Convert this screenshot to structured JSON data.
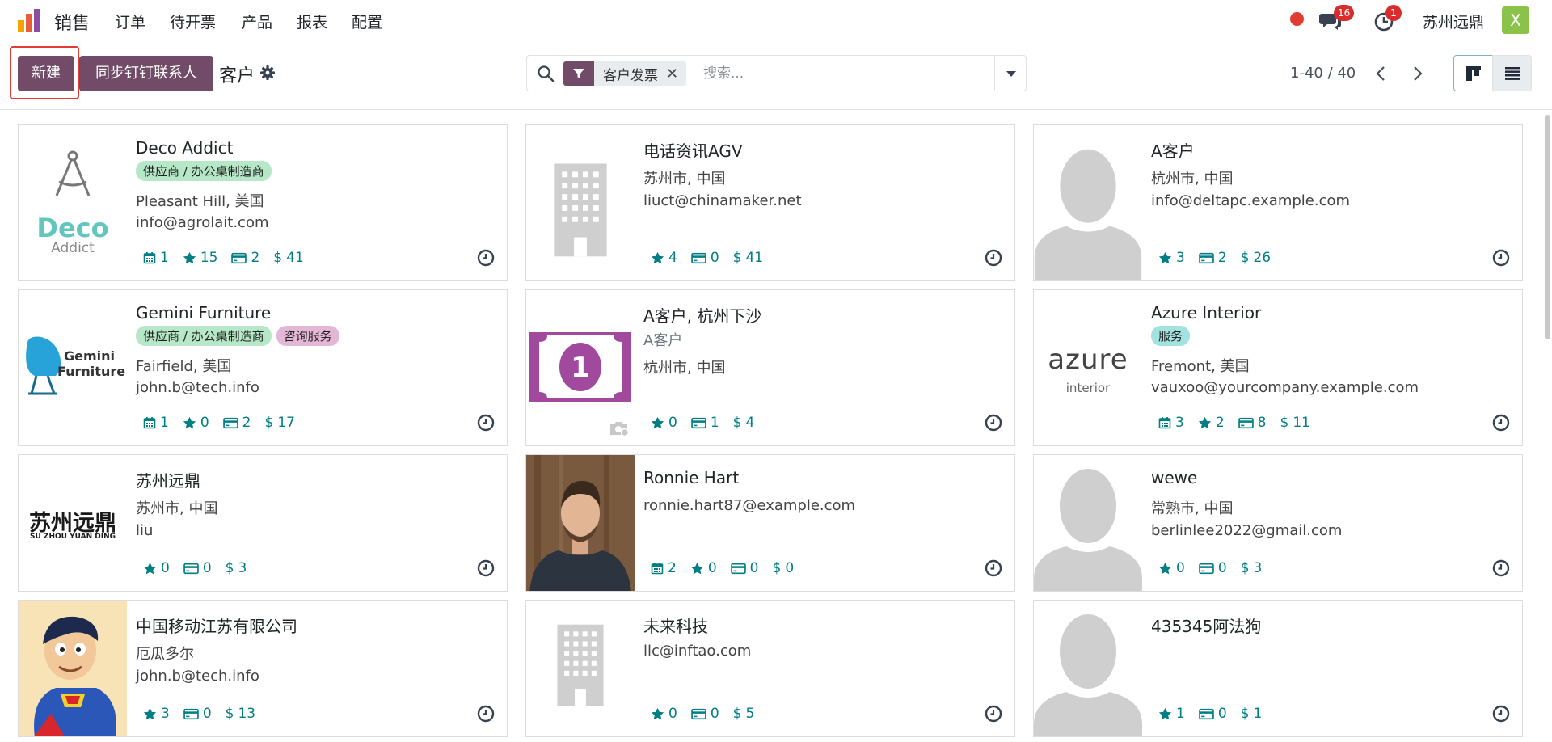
{
  "app": {
    "title": "销售",
    "menu": [
      "订单",
      "待开票",
      "产品",
      "报表",
      "配置"
    ],
    "messages_count": "16",
    "activities_count": "1",
    "company": "苏州远鼎",
    "user_initial": "X"
  },
  "actions": {
    "new_label": "新建",
    "sync_label": "同步钉钉联系人"
  },
  "breadcrumb": "客户",
  "search": {
    "facet": "客户发票",
    "placeholder": "搜索..."
  },
  "pager": "1-40 / 40",
  "colors": {
    "primary": "#714b67",
    "stat": "#017e84",
    "tag_supplier": "#b6e8c8",
    "tag_consult": "#e5b7d6",
    "tag_service": "#a2e3e2"
  },
  "cards": [
    {
      "name": "Deco Addict",
      "tags": [
        "供应商 / 办公桌制造商"
      ],
      "lines": [
        "Pleasant Hill, 美国",
        "info@agrolait.com"
      ],
      "image": "deco-addict-logo",
      "logo_text": [
        "Deco",
        "Addict"
      ],
      "stats": {
        "meetings": "1",
        "rating": "15",
        "invoices": "2",
        "sales": "41"
      }
    },
    {
      "name": "电话资讯AGV",
      "tags": [],
      "lines": [
        "苏州市, 中国",
        "liuct@chinamaker.net"
      ],
      "image": "building-placeholder",
      "stats": {
        "rating": "4",
        "invoices": "0",
        "sales": "41"
      }
    },
    {
      "name": "A客户",
      "tags": [],
      "lines": [
        "杭州市, 中国",
        "info@deltapc.example.com"
      ],
      "image": "person-placeholder",
      "stats": {
        "rating": "3",
        "invoices": "2",
        "sales": "26"
      }
    },
    {
      "name": "Gemini Furniture",
      "tags": [
        "供应商 / 办公桌制造商",
        "咨询服务"
      ],
      "lines": [
        "Fairfield, 美国",
        "john.b@tech.info"
      ],
      "image": "gemini-logo",
      "logo_text": [
        "Gemini",
        "Furniture"
      ],
      "stats": {
        "meetings": "1",
        "rating": "0",
        "invoices": "2",
        "sales": "17"
      }
    },
    {
      "name": "A客户, 杭州下沙",
      "tags": [],
      "lines": [
        "A客户",
        "杭州市, 中国"
      ],
      "image": "banknote-image",
      "logo_text": [
        "1"
      ],
      "stats": {
        "rating": "0",
        "invoices": "1",
        "sales": "4"
      }
    },
    {
      "name": "Azure Interior",
      "tags": [
        "服务"
      ],
      "lines": [
        "Fremont, 美国",
        "vauxoo@yourcompany.example.com"
      ],
      "image": "azure-logo",
      "logo_text": [
        "azure",
        "interior"
      ],
      "stats": {
        "meetings": "3",
        "rating": "2",
        "invoices": "8",
        "sales": "11"
      }
    },
    {
      "name": "苏州远鼎",
      "tags": [],
      "lines": [
        "苏州市, 中国",
        "liu"
      ],
      "image": "suzhou-yuanding-logo",
      "logo_text": [
        "苏州远鼎",
        "SU ZHOU YUAN DING"
      ],
      "stats": {
        "rating": "0",
        "invoices": "0",
        "sales": "3"
      }
    },
    {
      "name": "Ronnie Hart",
      "tags": [],
      "lines": [
        "ronnie.hart87@example.com"
      ],
      "image": "person-photo",
      "stats": {
        "meetings": "2",
        "rating": "0",
        "invoices": "0",
        "sales": "0"
      }
    },
    {
      "name": "wewe",
      "tags": [],
      "lines": [
        "常熟市, 中国",
        "berlinlee2022@gmail.com"
      ],
      "image": "person-placeholder",
      "stats": {
        "rating": "0",
        "invoices": "0",
        "sales": "3"
      }
    },
    {
      "name": "中国移动江苏有限公司",
      "tags": [],
      "lines": [
        "厄瓜多尔",
        "john.b@tech.info"
      ],
      "image": "superhero-cartoon",
      "stats": {
        "rating": "3",
        "invoices": "0",
        "sales": "13"
      }
    },
    {
      "name": "未来科技",
      "tags": [],
      "lines": [
        "llc@inftao.com"
      ],
      "image": "building-placeholder",
      "stats": {
        "rating": "0",
        "invoices": "0",
        "sales": "5"
      }
    },
    {
      "name": "435345阿法狗",
      "tags": [],
      "lines": [],
      "image": "person-placeholder",
      "stats": {
        "rating": "1",
        "invoices": "0",
        "sales": "1"
      }
    }
  ]
}
